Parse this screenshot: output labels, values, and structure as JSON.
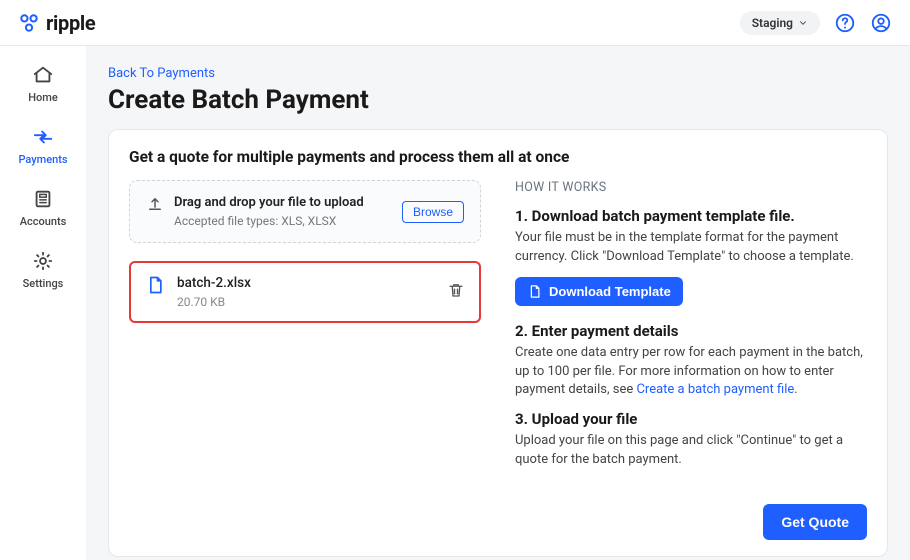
{
  "brand": "ripple",
  "env": {
    "label": "Staging"
  },
  "nav": {
    "home": "Home",
    "payments": "Payments",
    "accounts": "Accounts",
    "settings": "Settings"
  },
  "breadcrumb": "Back To Payments",
  "page_title": "Create Batch Payment",
  "card": {
    "heading": "Get a quote for multiple payments and process them all at once",
    "dropzone": {
      "title": "Drag and drop your file to upload",
      "accepted": "Accepted file types: XLS, XLSX",
      "browse": "Browse"
    },
    "uploaded_file": {
      "name": "batch-2.xlsx",
      "size": "20.70 KB"
    },
    "hiw_label": "HOW IT WORKS",
    "step1_title": "1. Download batch payment template file.",
    "step1_body": "Your file must be in the template format for the payment currency. Click \"Download Template\" to choose a template.",
    "download_template_label": "Download Template",
    "step2_title": "2. Enter payment details",
    "step2_body_a": "Create one data entry per row for each payment in the batch, up to 100 per file. For more information on how to enter payment details, see ",
    "step2_link": "Create a batch payment file",
    "step2_body_b": ".",
    "step3_title": "3. Upload your file",
    "step3_body": "Upload your file on this page and click \"Continue\" to get a quote for the batch payment.",
    "get_quote_label": "Get Quote"
  }
}
